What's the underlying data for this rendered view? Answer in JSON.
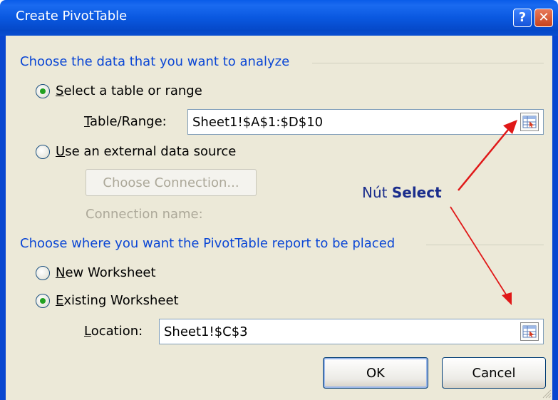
{
  "window": {
    "title": "Create PivotTable",
    "help_glyph": "?",
    "close_glyph": "✕"
  },
  "data_section": {
    "heading": "Choose the data that you want to analyze",
    "select_table": {
      "mnemonic": "S",
      "rest": "elect a table or range",
      "checked": true
    },
    "table_range": {
      "label_mnemonic": "T",
      "label_rest": "able/Range:",
      "value": "Sheet1!$A$1:$D$10"
    },
    "external_source": {
      "mnemonic": "U",
      "rest": "se an external data source",
      "checked": false
    },
    "choose_connection_label": "Choose Connection...",
    "connection_name_label": "Connection name:"
  },
  "placement_section": {
    "heading": "Choose where you want the PivotTable report to be placed",
    "new_worksheet": {
      "mnemonic": "N",
      "rest": "ew Worksheet",
      "checked": false
    },
    "existing_worksheet": {
      "mnemonic": "E",
      "rest": "xisting Worksheet",
      "checked": true
    },
    "location": {
      "label_mnemonic": "L",
      "label_rest": "ocation:",
      "value": "Sheet1!$C$3"
    }
  },
  "buttons": {
    "ok_label": "OK",
    "cancel_label": "Cancel"
  },
  "annotation": {
    "prefix": "Nút ",
    "bold": "Select",
    "arrow_color": "#e01818"
  },
  "colors": {
    "titlebar": "#0a58e0",
    "dialog_bg": "#ece9d8",
    "section_heading": "#0a46d5",
    "radio_dot": "#21a121"
  }
}
